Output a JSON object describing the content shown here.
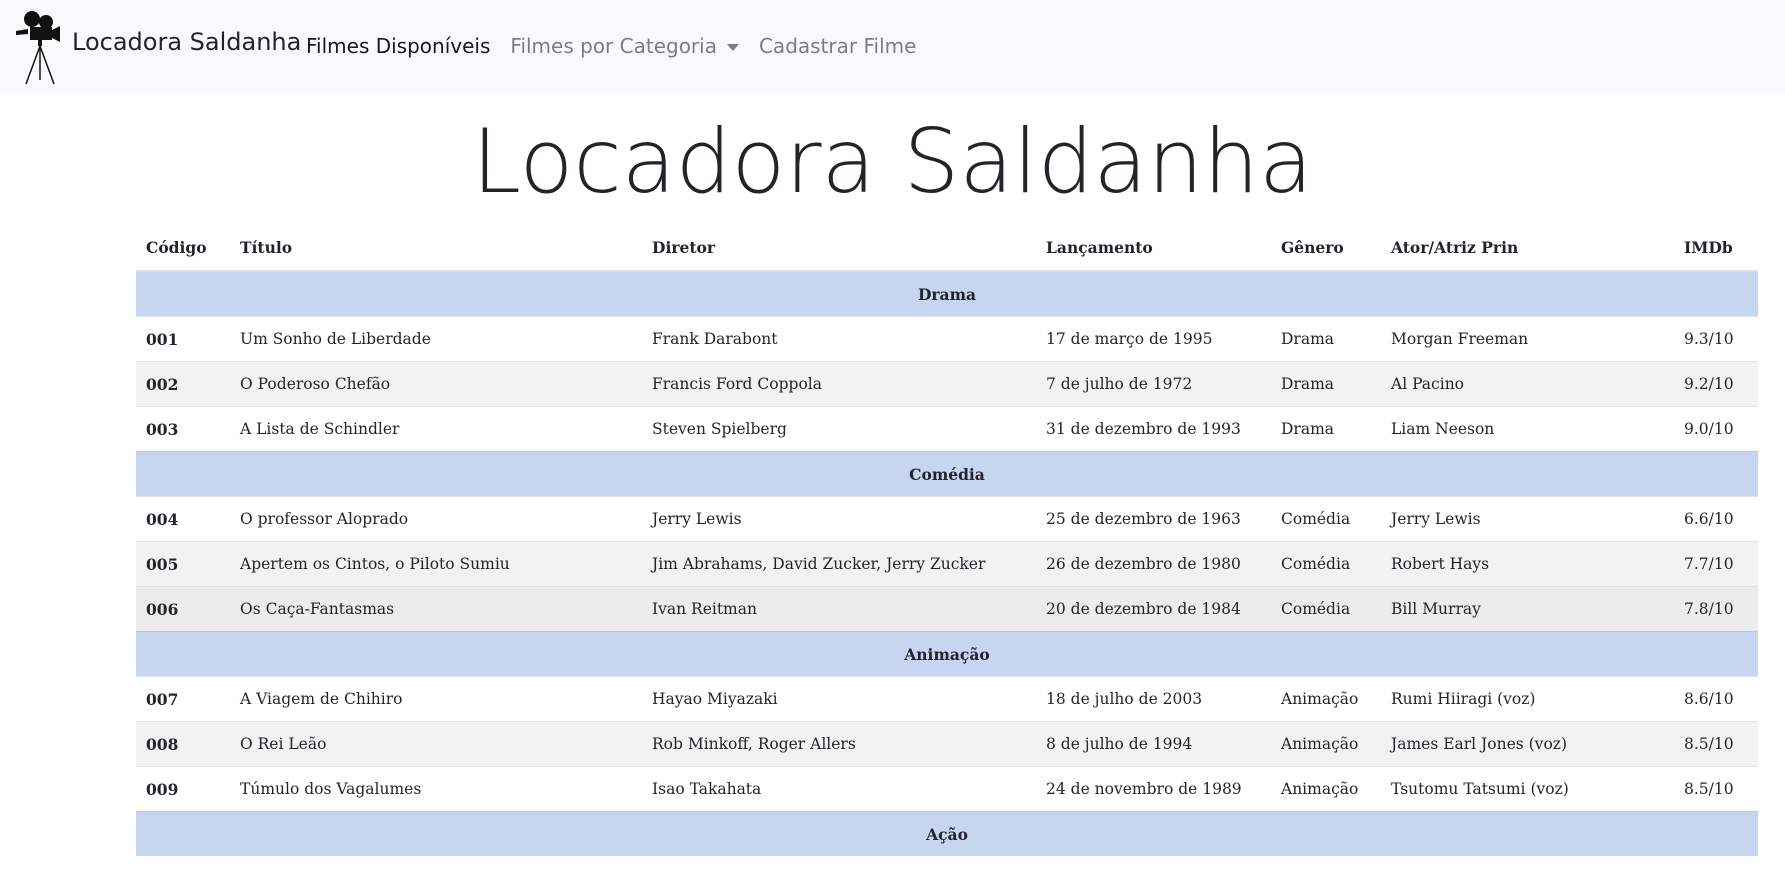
{
  "navbar": {
    "brand": "Locadora Saldanha",
    "links": [
      {
        "label": "Filmes Disponíveis",
        "active": true
      },
      {
        "label": "Filmes por Categoria",
        "dropdown": true
      },
      {
        "label": "Cadastrar Filme"
      }
    ]
  },
  "page_title": "Locadora Saldanha",
  "table": {
    "headers": [
      "Código",
      "Título",
      "Diretor",
      "Lançamento",
      "Gênero",
      "Ator/Atriz Prin",
      "IMDb"
    ],
    "groups": [
      {
        "category": "Drama",
        "rows": [
          [
            "001",
            "Um Sonho de Liberdade",
            "Frank Darabont",
            "17 de março de 1995",
            "Drama",
            "Morgan Freeman",
            "9.3/10"
          ],
          [
            "002",
            "O Poderoso Chefão",
            "Francis Ford Coppola",
            "7 de julho de 1972",
            "Drama",
            "Al Pacino",
            "9.2/10"
          ],
          [
            "003",
            "A Lista de Schindler",
            "Steven Spielberg",
            "31 de dezembro de 1993",
            "Drama",
            "Liam Neeson",
            "9.0/10"
          ]
        ]
      },
      {
        "category": "Comédia",
        "rows": [
          [
            "004",
            "O professor Aloprado",
            "Jerry Lewis",
            "25 de dezembro de 1963",
            "Comédia",
            "Jerry Lewis",
            "6.6/10"
          ],
          [
            "005",
            "Apertem os Cintos, o Piloto Sumiu",
            "Jim Abrahams, David Zucker, Jerry Zucker",
            "26 de dezembro de 1980",
            "Comédia",
            "Robert Hays",
            "7.7/10"
          ],
          [
            "006",
            "Os Caça-Fantasmas",
            "Ivan Reitman",
            "20 de dezembro de 1984",
            "Comédia",
            "Bill Murray",
            "7.8/10"
          ]
        ]
      },
      {
        "category": "Animação",
        "rows": [
          [
            "007",
            "A Viagem de Chihiro",
            "Hayao Miyazaki",
            "18 de julho de 2003",
            "Animação",
            "Rumi Hiiragi (voz)",
            "8.6/10"
          ],
          [
            "008",
            "O Rei Leão",
            "Rob Minkoff, Roger Allers",
            "8 de julho de 1994",
            "Animação",
            "James Earl Jones (voz)",
            "8.5/10"
          ],
          [
            "009",
            "Túmulo dos Vagalumes",
            "Isao Takahata",
            "24 de novembro de 1989",
            "Animação",
            "Tsutomu Tatsumi (voz)",
            "8.5/10"
          ]
        ]
      },
      {
        "category": "Ação",
        "rows": []
      }
    ]
  },
  "colors": {
    "navbar_bg": "#f8f9fa",
    "category_row_bg": "#c6d6f1",
    "striped_row_bg": "#f2f2f2"
  }
}
